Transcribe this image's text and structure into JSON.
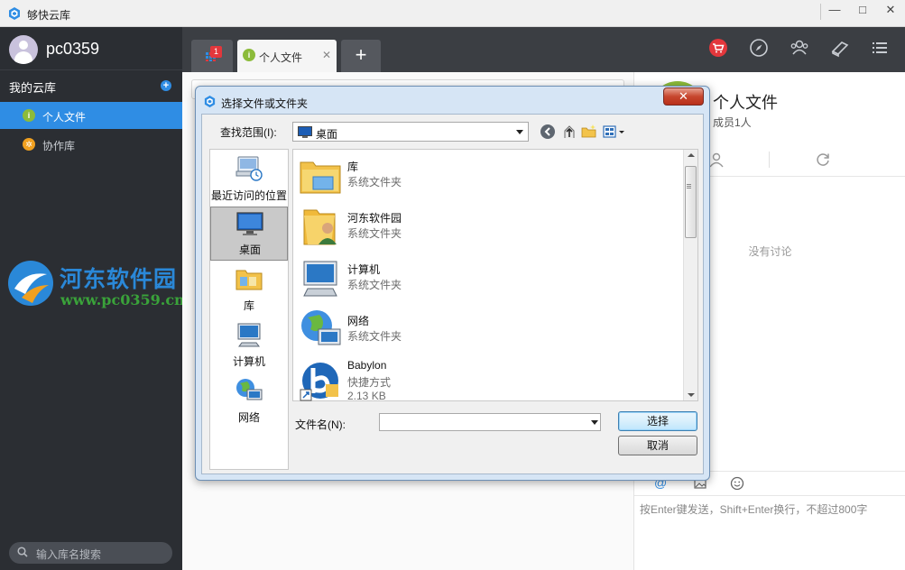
{
  "window": {
    "title": "够快云库",
    "minimize_glyph": "—",
    "maximize_glyph": "□",
    "close_glyph": "✕"
  },
  "sidebar": {
    "username": "pc0359",
    "section_title": "我的云库",
    "libraries": [
      {
        "label": "个人文件",
        "icon": "personal-files-icon",
        "color": "#8cbb3a",
        "active": true
      },
      {
        "label": "协作库",
        "icon": "collab-library-icon",
        "color": "#f0a020",
        "active": false
      }
    ],
    "search_placeholder": "输入库名搜索"
  },
  "watermark": {
    "title": "河东软件园",
    "url": "www.pc0359.cn"
  },
  "tabs": {
    "grid_badge": "1",
    "active_tab": "个人文件",
    "add_label": "+"
  },
  "toolbar_icons": [
    "shop-icon",
    "compass-icon",
    "contacts-icon",
    "book-icon",
    "menu-icon"
  ],
  "right_panel": {
    "title": "个人文件",
    "members": "成员1人",
    "empty_text": "没有讨论",
    "at_symbol": "@",
    "input_hint": "按Enter键发送，Shift+Enter换行，不超过800字"
  },
  "dialog": {
    "title": "选择文件或文件夹",
    "close_label": "✕",
    "look_in_label": "查找范围(I):",
    "look_in_value": "桌面",
    "places": [
      {
        "label": "最近访问的位置",
        "icon": "recent-places-icon"
      },
      {
        "label": "桌面",
        "icon": "desktop-icon"
      },
      {
        "label": "库",
        "icon": "library-icon"
      },
      {
        "label": "计算机",
        "icon": "computer-icon"
      },
      {
        "label": "网络",
        "icon": "network-icon"
      }
    ],
    "files": [
      {
        "name": "库",
        "type": "系统文件夹",
        "size": "",
        "icon": "library-folder-icon"
      },
      {
        "name": "河东软件园",
        "type": "系统文件夹",
        "size": "",
        "icon": "user-folder-icon"
      },
      {
        "name": "计算机",
        "type": "系统文件夹",
        "size": "",
        "icon": "computer-icon"
      },
      {
        "name": "网络",
        "type": "系统文件夹",
        "size": "",
        "icon": "network-icon"
      },
      {
        "name": "Babylon",
        "type": "快捷方式",
        "size": "2.13 KB",
        "icon": "babylon-shortcut-icon"
      }
    ],
    "filename_label": "文件名(N):",
    "filename_value": "",
    "select_button": "选择",
    "cancel_button": "取消"
  }
}
